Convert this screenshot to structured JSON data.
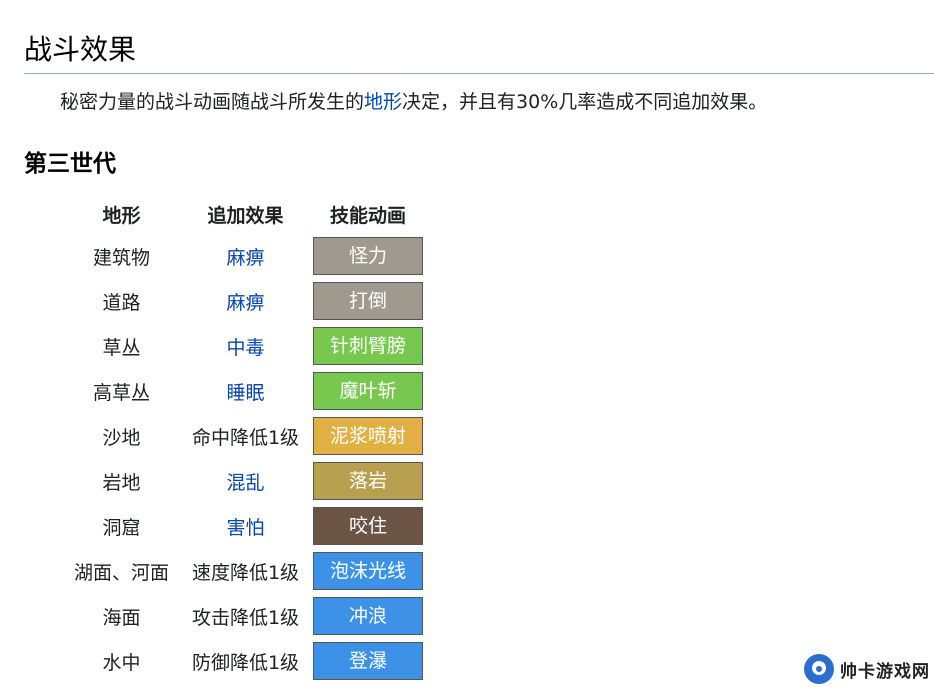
{
  "heading": "战斗效果",
  "intro": {
    "before": "秘密力量的战斗动画随战斗所发生的",
    "link": "地形",
    "after": "决定，并且有30%几率造成不同追加效果。"
  },
  "section_title": "第三世代",
  "table": {
    "headers": [
      "地形",
      "追加效果",
      "技能动画"
    ],
    "rows": [
      {
        "terrain": "建筑物",
        "effect": "麻痹",
        "effect_link": true,
        "move": "怪力",
        "color": "#a09a8e"
      },
      {
        "terrain": "道路",
        "effect": "麻痹",
        "effect_link": true,
        "move": "打倒",
        "color": "#a09a8e"
      },
      {
        "terrain": "草丛",
        "effect": "中毒",
        "effect_link": true,
        "move": "针刺臂膀",
        "color": "#78c850"
      },
      {
        "terrain": "高草丛",
        "effect": "睡眠",
        "effect_link": true,
        "move": "魔叶斩",
        "color": "#78c850"
      },
      {
        "terrain": "沙地",
        "effect": "命中降低1级",
        "effect_link": false,
        "move": "泥浆喷射",
        "color": "#e0b044"
      },
      {
        "terrain": "岩地",
        "effect": "混乱",
        "effect_link": true,
        "move": "落岩",
        "color": "#b8a050"
      },
      {
        "terrain": "洞窟",
        "effect": "害怕",
        "effect_link": true,
        "move": "咬住",
        "color": "#6b5444"
      },
      {
        "terrain": "湖面、河面",
        "effect": "速度降低1级",
        "effect_link": false,
        "move": "泡沫光线",
        "color": "#3d92e8"
      },
      {
        "terrain": "海面",
        "effect": "攻击降低1级",
        "effect_link": false,
        "move": "冲浪",
        "color": "#3d92e8"
      },
      {
        "terrain": "水中",
        "effect": "防御降低1级",
        "effect_link": false,
        "move": "登瀑",
        "color": "#3d92e8"
      }
    ]
  },
  "watermark": {
    "text": "帅卡游戏网",
    "icon": "watermark-logo-icon",
    "color": "#2a6fcf"
  }
}
